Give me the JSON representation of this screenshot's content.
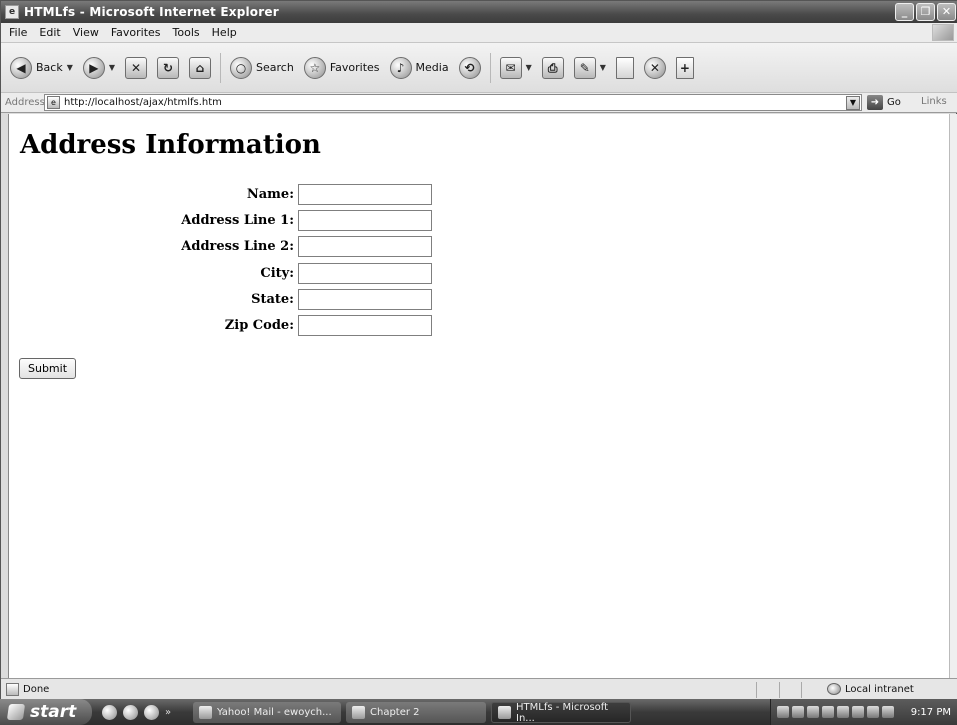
{
  "window": {
    "title": "HTMLfs - Microsoft Internet Explorer",
    "controls": [
      "_",
      "❐",
      "✕"
    ]
  },
  "menu": [
    "File",
    "Edit",
    "View",
    "Favorites",
    "Tools",
    "Help"
  ],
  "toolbar": {
    "back_label": "Back",
    "search_label": "Search",
    "favorites_label": "Favorites",
    "media_label": "Media"
  },
  "address": {
    "label": "Address",
    "url": "http://localhost/ajax/htmlfs.htm",
    "go_label": "Go",
    "links_label": "Links"
  },
  "page": {
    "heading": "Address Information",
    "fields": [
      {
        "label": "Name:",
        "value": ""
      },
      {
        "label": "Address Line 1:",
        "value": ""
      },
      {
        "label": "Address Line 2:",
        "value": ""
      },
      {
        "label": "City:",
        "value": ""
      },
      {
        "label": "State:",
        "value": ""
      },
      {
        "label": "Zip Code:",
        "value": ""
      }
    ],
    "submit_label": "Submit"
  },
  "status": {
    "text": "Done",
    "zone": "Local intranet"
  },
  "taskbar": {
    "start_label": "start",
    "tasks": [
      {
        "label": "Yahoo! Mail - ewoych..."
      },
      {
        "label": "Chapter 2"
      },
      {
        "label": "HTMLfs - Microsoft In..."
      }
    ],
    "clock": "9:17 PM"
  }
}
